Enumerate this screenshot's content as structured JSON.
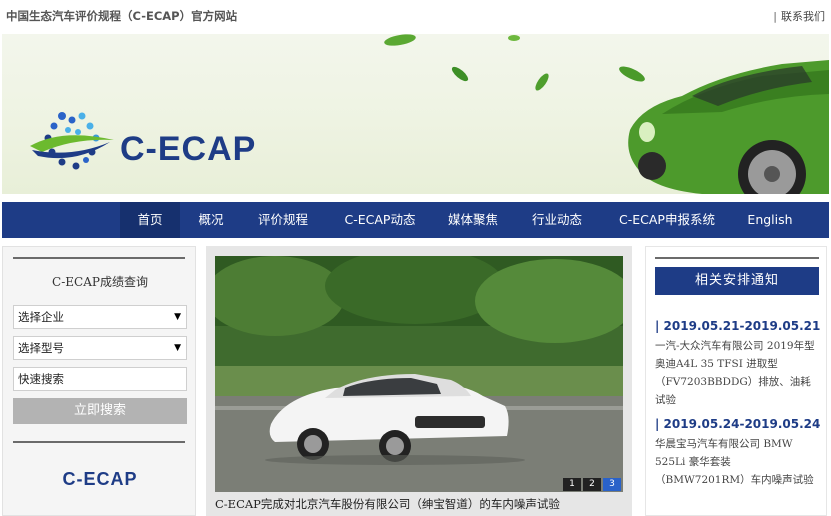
{
  "header": {
    "site_title": "中国生态汽车评价规程（C-ECAP）官方网站",
    "contact_separator": "|",
    "contact_label": "联系我们"
  },
  "banner": {
    "logo_text": "C-ECAP"
  },
  "nav": {
    "items": [
      {
        "label": "首页",
        "active": true
      },
      {
        "label": "概况"
      },
      {
        "label": "评价规程"
      },
      {
        "label": "C-ECAP动态"
      },
      {
        "label": "媒体聚焦"
      },
      {
        "label": "行业动态"
      },
      {
        "label": "C-ECAP申报系统"
      },
      {
        "label": "English"
      }
    ]
  },
  "query": {
    "title": "C-ECAP成绩查询",
    "company_select": "选择企业",
    "model_select": "选择型号",
    "quick_search": "快速搜索",
    "search_button": "立即搜索",
    "logo_text": "C-ECAP"
  },
  "slider": {
    "caption": "C-ECAP完成对北京汽车股份有限公司（绅宝智道）的车内噪声试验",
    "pages": [
      "1",
      "2",
      "3"
    ],
    "active_page": 3
  },
  "notices": {
    "title": "相关安排通知",
    "items": [
      {
        "date": "| 2019.05.21-2019.05.21",
        "text": "一汽-大众汽车有限公司 2019年型奥迪A4L 35 TFSI 进取型（FV7203BBDDG）排放、油耗试验"
      },
      {
        "date": "| 2019.05.24-2019.05.24",
        "text": "华晨宝马汽车有限公司 BMW 525Li 豪华套装（BMW7201RM）车内噪声试验"
      }
    ]
  },
  "colors": {
    "brand_blue": "#1e3c86",
    "nav_active": "#16306e",
    "pager_active": "#2a62c9"
  }
}
